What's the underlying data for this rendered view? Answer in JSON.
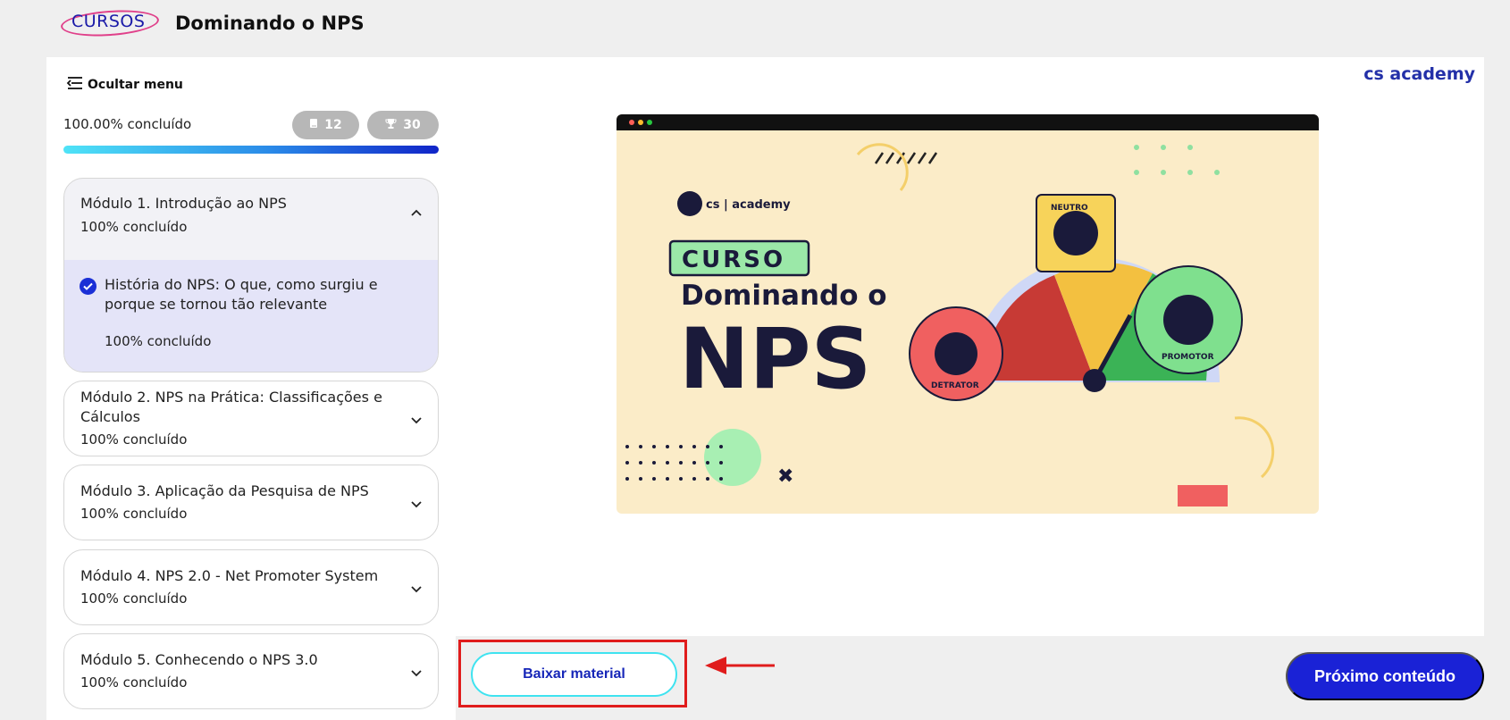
{
  "header": {
    "logo_text": "CURSOS",
    "course_title": "Dominando o NPS"
  },
  "sidebar": {
    "hide_menu_label": "Ocultar menu",
    "progress_label": "100.00% concluído",
    "lessons_count": "12",
    "points_count": "30",
    "progress_value": 1.0,
    "modules": [
      {
        "title": "Módulo 1. Introdução ao NPS",
        "progress": "100% concluído",
        "expanded": true,
        "lessons": [
          {
            "title": "História do NPS: O que, como surgiu e porque se tornou tão relevante",
            "progress": "100% concluído"
          }
        ]
      },
      {
        "title": "Módulo 2. NPS na Prática: Classificações e Cálculos",
        "progress": "100% concluído",
        "expanded": false
      },
      {
        "title": "Módulo 3. Aplicação da Pesquisa de NPS",
        "progress": "100% concluído",
        "expanded": false
      },
      {
        "title": "Módulo 4. NPS 2.0 - Net Promoter System",
        "progress": "100% concluído",
        "expanded": false
      },
      {
        "title": "Módulo 5. Conhecendo o NPS 3.0",
        "progress": "100% concluído",
        "expanded": false
      }
    ]
  },
  "content": {
    "brand_logo": "cs academy",
    "banner": {
      "brand": "cs | academy",
      "badge": "CURSO",
      "line1": "Dominando o",
      "line2": "NPS",
      "neutral_label": "NEUTRO",
      "detractor_label": "DETRATOR",
      "promoter_label": "PROMOTOR"
    }
  },
  "footer": {
    "download_label": "Baixar material",
    "next_label": "Próximo conteúdo"
  },
  "colors": {
    "accent": "#1a22d6",
    "cyan": "#3fe3f0",
    "highlight_frame": "#e01c1c",
    "lesson_bg": "#e4e4f8"
  }
}
